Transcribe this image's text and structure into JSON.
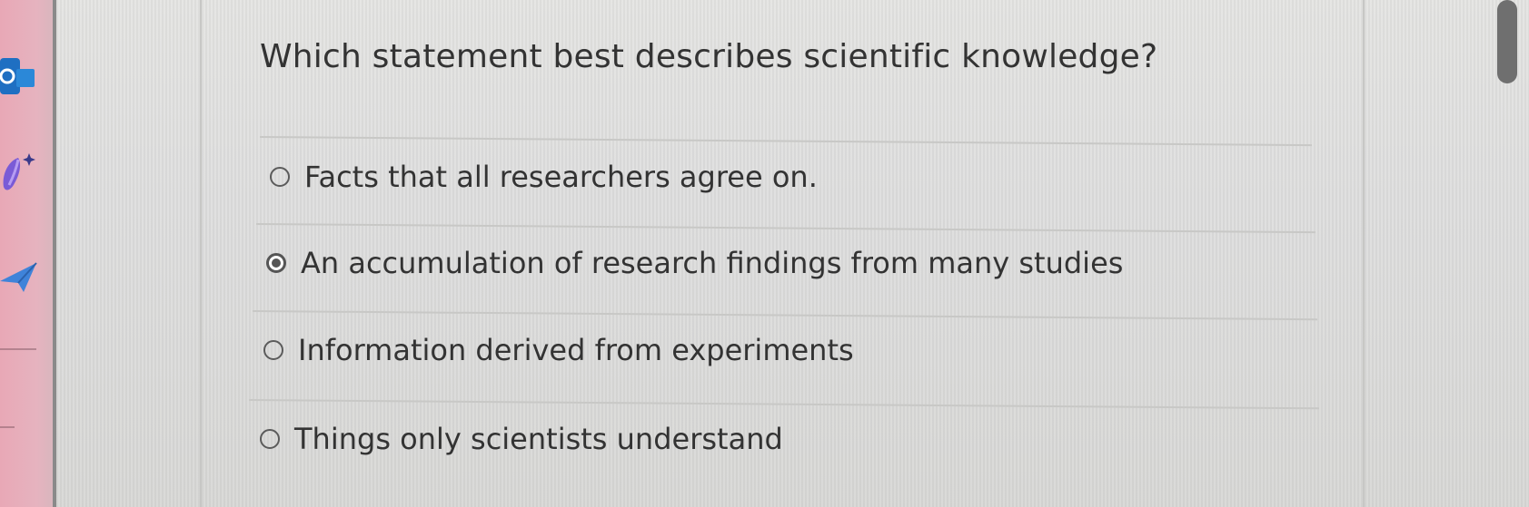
{
  "question": {
    "text": "Which statement best describes scientific knowledge?"
  },
  "options": [
    {
      "label": "Facts that all researchers agree on.",
      "selected": false
    },
    {
      "label": "An accumulation of research findings from many studies",
      "selected": true
    },
    {
      "label": "Information derived from experiments",
      "selected": false
    },
    {
      "label": "Things only scientists understand",
      "selected": false
    }
  ],
  "dock": {
    "icons": [
      "outlook-icon",
      "copilot-icon",
      "send-icon"
    ]
  },
  "colors": {
    "text": "#333333",
    "radio": "#555555",
    "dock_background": "#e6b3bf",
    "outlook_blue": "#1f6fc2"
  }
}
